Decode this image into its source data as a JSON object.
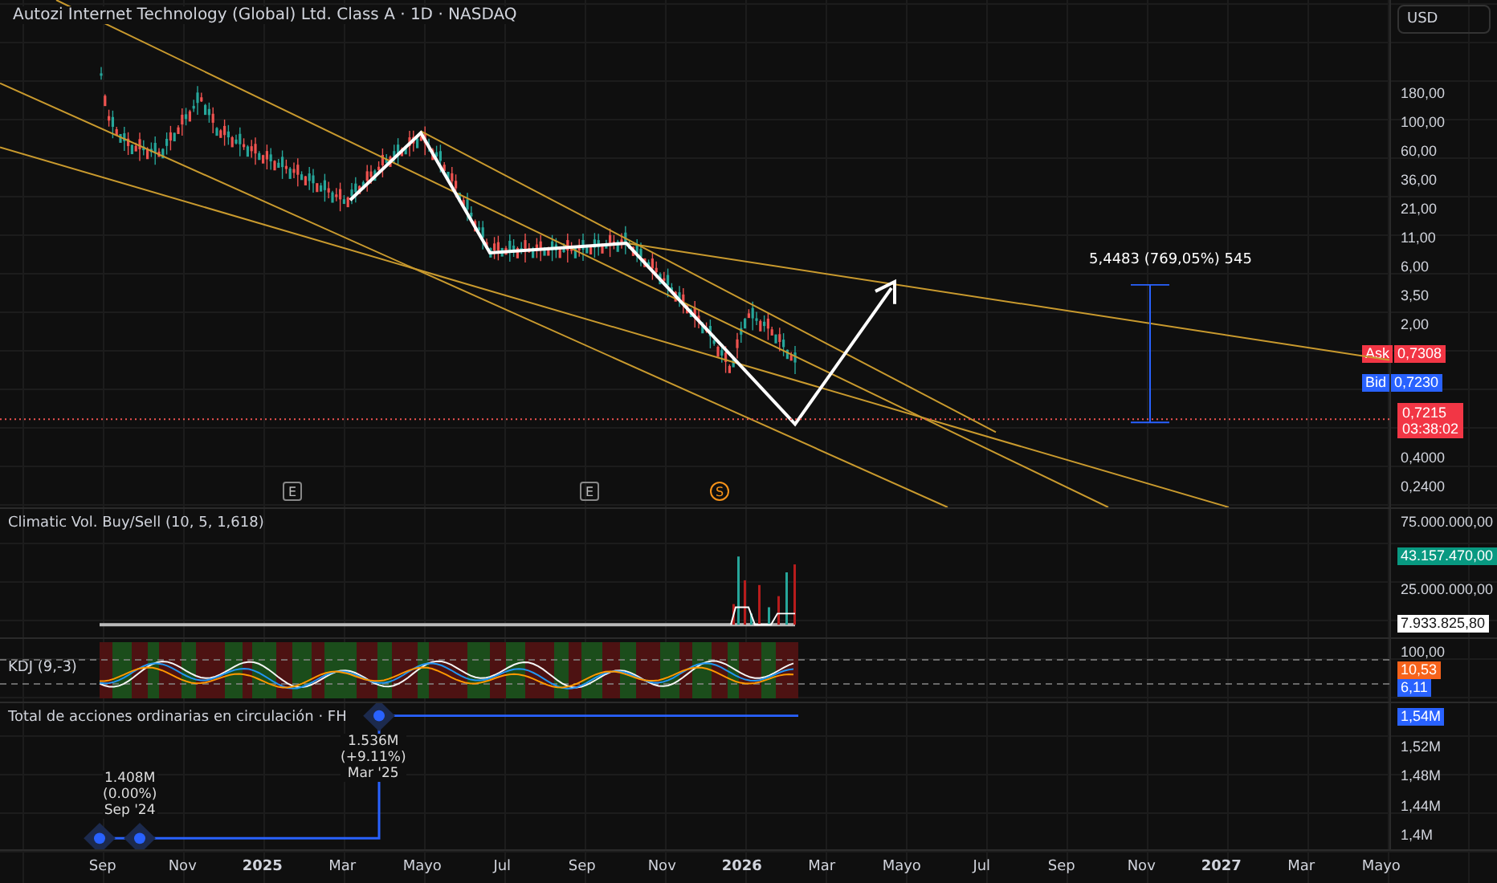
{
  "chart": {
    "title": "Autozi Internet Technology (Global) Ltd. Class A · 1D · NASDAQ",
    "currency": "USD",
    "measure_label": "5,4483 (769,05%) 545",
    "price_axis": [
      {
        "kind": "tick",
        "text": "180,00"
      },
      {
        "kind": "tick",
        "text": "100,00"
      },
      {
        "kind": "tick",
        "text": "60,00"
      },
      {
        "kind": "tick",
        "text": "36,00"
      },
      {
        "kind": "tick",
        "text": "21,00"
      },
      {
        "kind": "tick",
        "text": "11,00"
      },
      {
        "kind": "tick",
        "text": "6,00"
      },
      {
        "kind": "tick",
        "text": "3,50"
      },
      {
        "kind": "tick",
        "text": "2,00"
      },
      {
        "kind": "ask",
        "label": "Ask",
        "text": "0,7308"
      },
      {
        "kind": "bid",
        "label": "Bid",
        "text": "0,7230"
      },
      {
        "kind": "last",
        "text": "0,7215",
        "countdown": "03:38:02"
      },
      {
        "kind": "tick",
        "text": "0,4000"
      },
      {
        "kind": "tick",
        "text": "0,2400"
      }
    ],
    "event_markers": [
      {
        "kind": "earnings",
        "label": "E"
      },
      {
        "kind": "earnings",
        "label": "E"
      },
      {
        "kind": "split",
        "label": "S"
      }
    ]
  },
  "climatic": {
    "title": "Climatic Vol. Buy/Sell (10, 5, 1,618)",
    "axis": [
      {
        "kind": "tick",
        "text": "75.000.000,00"
      },
      {
        "kind": "green",
        "text": "43.157.470,00"
      },
      {
        "kind": "tick",
        "text": "25.000.000,00"
      },
      {
        "kind": "white",
        "text": "7.933.825,80"
      }
    ]
  },
  "kdj": {
    "title": "KDJ (9,-3)",
    "axis": [
      {
        "kind": "tick",
        "text": "100,00"
      },
      {
        "kind": "orange",
        "text": "10,53"
      },
      {
        "kind": "blue",
        "text": "6,11"
      }
    ]
  },
  "shares": {
    "title": "Total de acciones ordinarias en circulación · FH",
    "axis": [
      {
        "kind": "blue",
        "text": "1,54M"
      },
      {
        "kind": "tick",
        "text": "1,52M"
      },
      {
        "kind": "tick",
        "text": "1,48M"
      },
      {
        "kind": "tick",
        "text": "1,44M"
      },
      {
        "kind": "tick",
        "text": "1,4M"
      }
    ],
    "annotations": [
      {
        "value": "1.408M",
        "change": "(0.00%)",
        "date": "Sep '24"
      },
      {
        "value": "1.536M",
        "change": "(+9.11%)",
        "date": "Mar '25"
      }
    ]
  },
  "time_axis": [
    {
      "kind": "month",
      "text": "Sep"
    },
    {
      "kind": "month",
      "text": "Nov"
    },
    {
      "kind": "year",
      "text": "2025"
    },
    {
      "kind": "month",
      "text": "Mar"
    },
    {
      "kind": "month",
      "text": "Mayo"
    },
    {
      "kind": "month",
      "text": "Jul"
    },
    {
      "kind": "month",
      "text": "Sep"
    },
    {
      "kind": "month",
      "text": "Nov"
    },
    {
      "kind": "year",
      "text": "2026"
    },
    {
      "kind": "month",
      "text": "Mar"
    },
    {
      "kind": "month",
      "text": "Mayo"
    },
    {
      "kind": "month",
      "text": "Jul"
    },
    {
      "kind": "month",
      "text": "Sep"
    },
    {
      "kind": "month",
      "text": "Nov"
    },
    {
      "kind": "year",
      "text": "2027"
    },
    {
      "kind": "month",
      "text": "Mar"
    },
    {
      "kind": "month",
      "text": "Mayo"
    }
  ]
}
